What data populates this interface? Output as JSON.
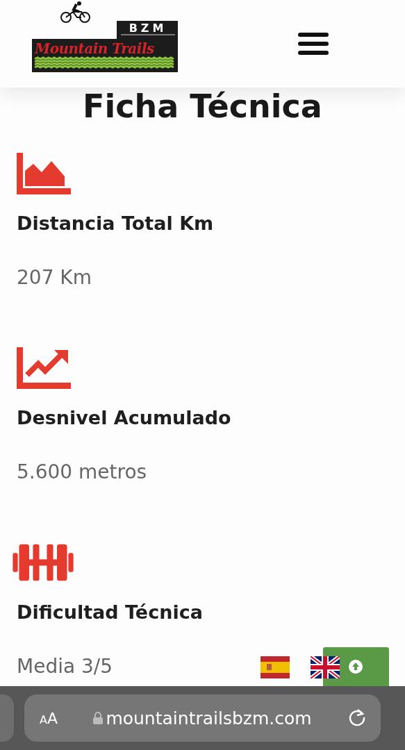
{
  "header": {
    "logo": {
      "badge": "BZM",
      "name": "Mountain Trails"
    }
  },
  "page_title": "Ficha Técnica",
  "specs": [
    {
      "kind": "area",
      "label": "Distancia Total Km",
      "value": "207 Km"
    },
    {
      "kind": "trend",
      "label": "Desnivel Acumulado",
      "value": "5.600 metros"
    },
    {
      "kind": "dumbbell",
      "label": "Dificultad Técnica",
      "value": "Media 3/5"
    }
  ],
  "languages": [
    {
      "kind": "es"
    },
    {
      "kind": "en"
    }
  ],
  "browser": {
    "text_size": "AA",
    "url": "mountaintrailsbzm.com"
  }
}
